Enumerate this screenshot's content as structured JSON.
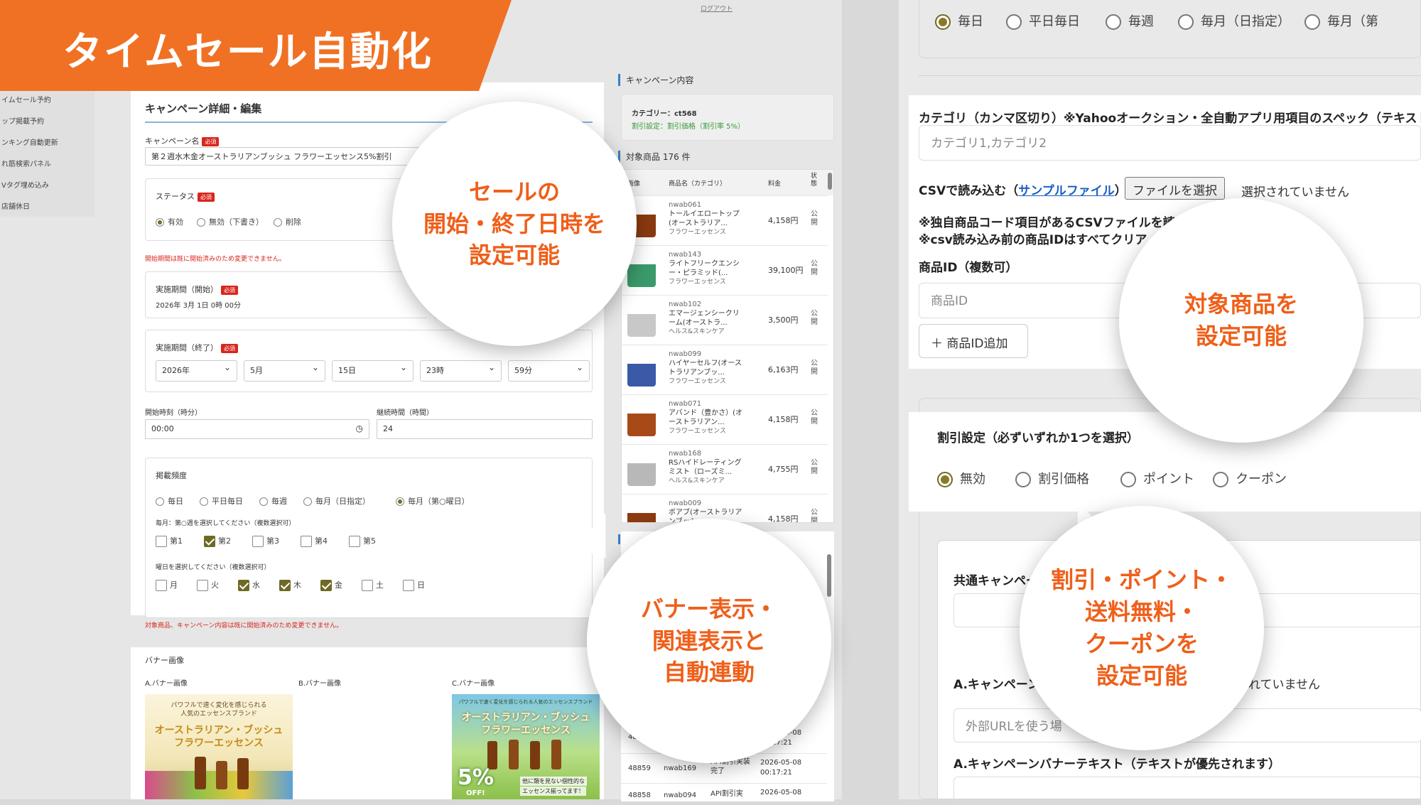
{
  "header": {
    "title": "タイムセール自動化"
  },
  "left_app": {
    "logout": "ログアウト",
    "side_menu": [
      "イムセール予約",
      "ップ掲載予約",
      "ンキング自動更新",
      "れ筋検索パネル",
      "Vタグ埋め込み",
      "店舗休日"
    ]
  },
  "form": {
    "title": "キャンペーン詳細・編集",
    "required_badge": "必須",
    "campaign_name_label": "キャンペーン名",
    "campaign_name_value": "第２週水木金オーストラリアンブッシュ フラワーエッセンス5%割引",
    "status_label": "ステータス",
    "status_options": [
      "有効",
      "無効（下書き）",
      "削除"
    ],
    "start_warning": "開始期間は既に開始済みのため変更できません。",
    "start_label": "実施期間（開始）",
    "start_value": "2026年 3月 1日 0時 00分",
    "end_label": "実施期間（終了）",
    "end_selects": [
      "2026年",
      "5月",
      "15日",
      "23時",
      "59分"
    ],
    "start_time_label": "開始時刻（時分）",
    "start_time_value": "00:00",
    "duration_label": "継続時間（時間）",
    "duration_value": "24",
    "frequency_label": "掲載頻度",
    "frequency_options": [
      "毎日",
      "平日毎日",
      "毎週",
      "毎月（日指定）",
      "毎月（第○曜日）"
    ],
    "week_hint": "毎月：第○週を選択してください（複数選択可）",
    "weeks": [
      "第1",
      "第2",
      "第3",
      "第4",
      "第5"
    ],
    "weekday_hint": "曜日を選択してください（複数選択可）",
    "weekdays": [
      "月",
      "火",
      "水",
      "木",
      "金",
      "土",
      "日"
    ],
    "bottom_warning": "対象商品、キャンペーン内容は既に開始済みのため変更できません。"
  },
  "banner_section": {
    "title": "バナー画像",
    "labels": [
      "A.バナー画像",
      "B.バナー画像",
      "C.バナー画像"
    ],
    "banner_a_top": "パワフルで速く変化を感じられる",
    "banner_a_top2": "人気のエッセンスブランド",
    "banner_a_brand": "オーストラリアン・ブッシュ",
    "banner_a_brand2": "フラワーエッセンス",
    "banner_c_top": "パワフルで速く変化を感じられる人気のエッセンスブランド",
    "banner_c_brand": "オーストラリアン・ブッシュ",
    "banner_c_brand2": "フラワーエッセンス",
    "banner_c_pct": "5%",
    "banner_c_off": "OFF!",
    "banner_c_note": "他に類を見ない個性的な",
    "banner_c_note2": "エッセンス揃ってます！"
  },
  "campaign": {
    "title": "キャンペーン内容",
    "category": "カテゴリー：ct568",
    "discount": "割引設定：割引価格（割引率 5%）"
  },
  "products": {
    "title": "対象商品 176 件",
    "headers": [
      "画像",
      "商品名（カテゴリ）",
      "料金",
      "状態"
    ],
    "status_text": "公開",
    "rows": [
      {
        "code": "nwab061",
        "name": "トールイエロートップ(オーストラリア...",
        "cat": "フラワーエッセンス",
        "price": "4,158円"
      },
      {
        "code": "nwab143",
        "name": "ライトフリークエンシー・ピラミッド(...",
        "cat": "フラワーエッセンス",
        "price": "39,100円"
      },
      {
        "code": "nwab102",
        "name": "エマージェンシークリーム(オーストラ...",
        "cat": "ヘルス&スキンケア",
        "price": "3,500円"
      },
      {
        "code": "nwab099",
        "name": "ハイヤーセルフ(オーストラリアンブッ...",
        "cat": "フラワーエッセンス",
        "price": "6,163円"
      },
      {
        "code": "nwab071",
        "name": "アバンド（豊かさ）(オーストラリアン...",
        "cat": "フラワーエッセンス",
        "price": "4,158円"
      },
      {
        "code": "nwab168",
        "name": "RSハイドレーティングミスト（ローズミ...",
        "cat": "ヘルス&スキンケア",
        "price": "4,755円"
      },
      {
        "code": "nwab009",
        "name": "ボアブ(オーストラリアンブッシ...",
        "cat": "フラワーエッセンス",
        "price": "4,158円"
      }
    ]
  },
  "history": [
    {
      "id": "4888",
      "code": "",
      "type": "",
      "date": "2026-05-08",
      "time": "00:17:21"
    },
    {
      "id": "48859",
      "code": "nwab169",
      "type": "API割引実装完了",
      "date": "2026-05-08",
      "time": "00:17:21"
    },
    {
      "id": "48858",
      "code": "nwab094",
      "type": "API割引実",
      "date": "2026-05-08",
      "time": ""
    }
  ],
  "right_app": {
    "frequency_options": [
      "毎日",
      "平日毎日",
      "毎週",
      "毎月（日指定）",
      "毎月（第"
    ],
    "category_label": "カテゴリ（カンマ区切り）※Yahooオークション・全自動アプリ用項目のスペック（テキスト）s",
    "category_placeholder": "カテゴリ1,カテゴリ2",
    "csv_label": "CSVで読み込む（",
    "csv_link": "サンプルファイル",
    "csv_close": "）",
    "file_button": "ファイルを選択",
    "file_status": "選択されていません",
    "note1": "※独自商品コード項目があるCSVファイルを読",
    "note2": "※csv読み込み前の商品IDはすべてクリア",
    "product_id_label": "商品ID（複数可）",
    "product_id_placeholder": "商品ID",
    "add_id_button": "＋ 商品ID追加",
    "discount_label": "割引設定（必ずいずれか1つを選択）",
    "discount_options": [
      "無効",
      "割引価格",
      "ポイント",
      "クーポン"
    ],
    "common_label": "共通キャンペー",
    "banner_a_label": "A.キャンペーン",
    "banner_a_status": "されていません",
    "external_url_placeholder": "外部URLを使う場",
    "banner_text_label": "A.キャンペーンバナーテキスト（テキストが優先されます）"
  },
  "bubbles": {
    "b1": [
      "セールの",
      "開始・終了日時を",
      "設定可能"
    ],
    "b2": [
      "バナー表示・",
      "関連表示と",
      "自動連動"
    ],
    "b3": [
      "対象商品を",
      "設定可能"
    ],
    "b4": [
      "割引・ポイント・",
      "送料無料・",
      "クーポンを",
      "設定可能"
    ]
  },
  "colors": {
    "accent": "#f07123",
    "bubble_text": "#ef5f1a",
    "checked": "#6d6a25"
  }
}
